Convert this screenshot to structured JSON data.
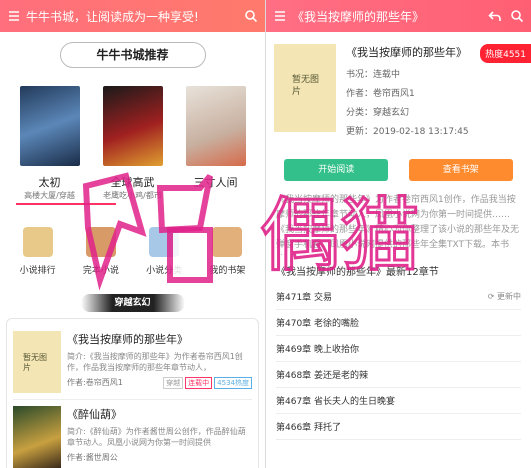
{
  "left": {
    "header_title": "牛牛书城，让阅读成为一种享受!",
    "section_title": "牛牛书城推荐",
    "recommend": [
      {
        "title": "太初",
        "sub": "高楼大厦/穿越"
      },
      {
        "title": "全球高武",
        "sub": "老鹰吃小鸡/都市"
      },
      {
        "title": "三寸人间",
        "sub": ""
      }
    ],
    "nav": [
      {
        "label": "小说排行"
      },
      {
        "label": "完本小说"
      },
      {
        "label": "小说分类"
      },
      {
        "label": "我的书架"
      }
    ],
    "category": "穿越玄幻",
    "list": [
      {
        "title": "《我当按摩师的那些年》",
        "desc": "简介:《我当按摩师的那些年》为作者卷帘西风1创作，作品我当按摩师的那些年章节动人，",
        "author": "作者:卷帘西风1",
        "tags": [
          "穿越",
          "连载中",
          "4534热度"
        ]
      },
      {
        "title": "《醉仙葫》",
        "desc": "简介:《醉仙葫》为作者酱世周公创作，作品醉仙葫章节动人。凤凰小说网为你第一时间提供",
        "author": "作者:酱世周公",
        "tags": []
      }
    ],
    "cover_text": "暂无图片"
  },
  "right": {
    "header_title": "《我当按摩师的那些年》",
    "book_title": "《我当按摩师的那些年》",
    "heat": "热度4551",
    "status": "书况：连载中",
    "author": "作者：卷帘西风1",
    "category": "分类：穿越玄幻",
    "updated": "更新：2019-02-18 13:17:45",
    "cover_text": "暂无图片",
    "read_button": "开始阅读",
    "shelf_button": "查看书架",
    "intro": "《我当按摩师的那些年》为作者卷帘西风1创作，作品我当按摩师的那些年章节动人，凤凰小说网为你第一时间提供……《我当按摩师的那些年》精心为你整理了该小说的那些年及无弹窗手机看。凤凰小说网提供的那些年全集TXT下载。本书籍...",
    "latest_title": "《我当按摩师的那些年》最新12章节",
    "update_list_label": "更新中",
    "chapters": [
      "第471章 交易",
      "第470章 老徐的嘴脸",
      "第469章 晚上收拾你",
      "第468章 姜还是老的辣",
      "第467章 省长夫人的生日晚宴",
      "第466章 拜托了"
    ]
  },
  "watermark": "偶猫",
  "colors": {
    "header": "#ff6f7d",
    "read": "#33c08a",
    "shelf": "#ff8b2f",
    "heat": "#ff2233",
    "watermark": "#e0228a"
  }
}
